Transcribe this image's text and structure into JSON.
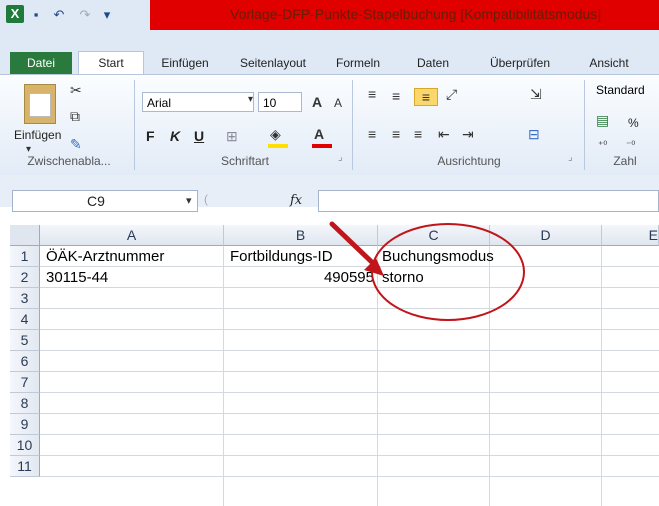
{
  "window": {
    "title": "Vorlage-DFP-Punkte-Stapelbuchung  [Kompatibilitätsmodus]",
    "app_icon": "X",
    "brand_color": "#2a7a3e",
    "title_highlight_color": "#e00000"
  },
  "ribbon": {
    "tabs": [
      "Datei",
      "Start",
      "Einfügen",
      "Seitenlayout",
      "Formeln",
      "Daten",
      "Überprüfen",
      "Ansicht"
    ],
    "active_tab": "Start",
    "paste_label": "Einfügen",
    "font_name": "Arial",
    "font_size": "10",
    "bold": "F",
    "italic": "K",
    "underline": "U",
    "number_format": "Standard",
    "percent": "%",
    "groups": {
      "clipboard": "Zwischenabla...",
      "font": "Schriftart",
      "alignment": "Ausrichtung",
      "number": "Zahl"
    }
  },
  "formula_bar": {
    "name_box": "C9",
    "fx": "fx",
    "formula": ""
  },
  "sheet": {
    "columns": [
      "A",
      "B",
      "C",
      "D",
      "E"
    ],
    "rows": [
      "1",
      "2",
      "3",
      "4",
      "5",
      "6",
      "7",
      "8",
      "9",
      "10",
      "11"
    ],
    "cells": {
      "A1": "ÖÄK-Arztnummer",
      "B1": "Fortbildungs-ID",
      "C1": "Buchungsmodus",
      "A2": "30115-44",
      "B2": "490595",
      "C2": "storno"
    }
  },
  "annotation": {
    "color": "#c0151a",
    "icons": [
      "arrow-annotation",
      "ellipse-annotation"
    ]
  }
}
